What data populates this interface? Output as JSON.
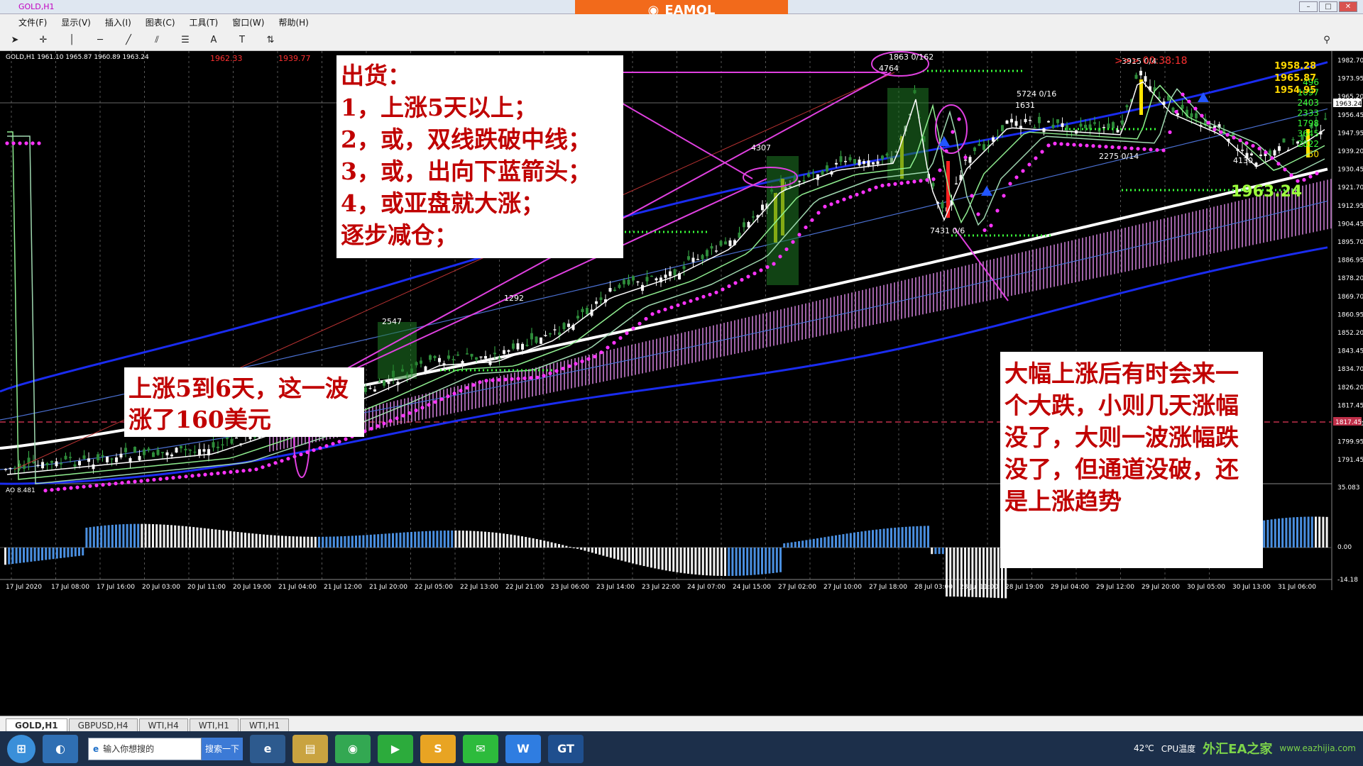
{
  "title_bar": {
    "window_title": "GOLD,H1",
    "brand": "EAMOL"
  },
  "menu": [
    "文件(F)",
    "显示(V)",
    "插入(I)",
    "图表(C)",
    "工具(T)",
    "窗口(W)",
    "帮助(H)"
  ],
  "chart": {
    "symbol_line": "GOLD,H1  1961.10 1965.87 1960.89 1963.24",
    "top_values": [
      "1962.33",
      "1939.77"
    ],
    "timer": ">>> 00:38:18",
    "right_panel": [
      "1958.28",
      "1965.87",
      "1954.95",
      "1963.24"
    ],
    "right_small": [
      "496",
      "1097",
      "2403",
      "2333",
      "1798",
      "3645",
      "2822",
      "50"
    ],
    "price_axis": [
      "1982.70",
      "1973.95",
      "1965.20",
      "1956.45",
      "1947.95",
      "1939.20",
      "1930.45",
      "1921.70",
      "1912.95",
      "1904.45",
      "1895.70",
      "1886.95",
      "1878.20",
      "1869.70",
      "1860.95",
      "1852.20",
      "1843.45",
      "1834.70",
      "1826.20",
      "1817.45",
      "1808.70",
      "1799.95",
      "1791.45"
    ],
    "current_price_tag": "1963.24",
    "dashed_line_tag": "1817.45",
    "big_price": "1963.24",
    "labels": [
      "2547",
      "1292",
      "4307",
      "4764",
      "1863 0/162",
      "5724 0/16",
      "1631",
      "7431 0/6",
      "2275 0/14",
      "3915 0/4",
      "4130"
    ],
    "ao_label": "AO 8.481",
    "ao_axis": [
      "35.083",
      "0.00",
      "-14.18"
    ],
    "time_axis": [
      "17 Jul 2020",
      "17 Jul 08:00",
      "17 Jul 16:00",
      "20 Jul 03:00",
      "20 Jul 11:00",
      "20 Jul 19:00",
      "21 Jul 04:00",
      "21 Jul 12:00",
      "21 Jul 20:00",
      "22 Jul 05:00",
      "22 Jul 13:00",
      "22 Jul 21:00",
      "23 Jul 06:00",
      "23 Jul 14:00",
      "23 Jul 22:00",
      "24 Jul 07:00",
      "24 Jul 15:00",
      "27 Jul 02:00",
      "27 Jul 10:00",
      "27 Jul 18:00",
      "28 Jul 03:00",
      "28 Jul 11:00",
      "28 Jul 19:00",
      "29 Jul 04:00",
      "29 Jul 12:00",
      "29 Jul 20:00",
      "30 Jul 05:00",
      "30 Jul 13:00",
      "31 Jul 06:00"
    ]
  },
  "notes": {
    "sell": [
      "出货：",
      "1，上涨5天以上；",
      "2，或，双线跌破中线；",
      "3，或，出向下蓝箭头；",
      "4，或亚盘就大涨；",
      "逐步减仓；"
    ],
    "rise": [
      "上涨5到6天，这一波",
      "涨了160美元"
    ],
    "drop": [
      "大幅上涨后有时会来一",
      "个大跌，小则几天涨幅",
      "没了，大则一波涨幅跌",
      "没了，但通道没破，还",
      "是上涨趋势"
    ]
  },
  "tabs": [
    "GOLD,H1",
    "GBPUSD,H4",
    "WTI,H4",
    "WTI,H1",
    "WTI,H1"
  ],
  "taskbar": {
    "search_placeholder": "输入你想搜的",
    "search_button": "搜索一下",
    "temp": "42℃",
    "cpu": "CPU温度",
    "site": "外汇EA之家",
    "site_url": "www.eazhijia.com"
  }
}
